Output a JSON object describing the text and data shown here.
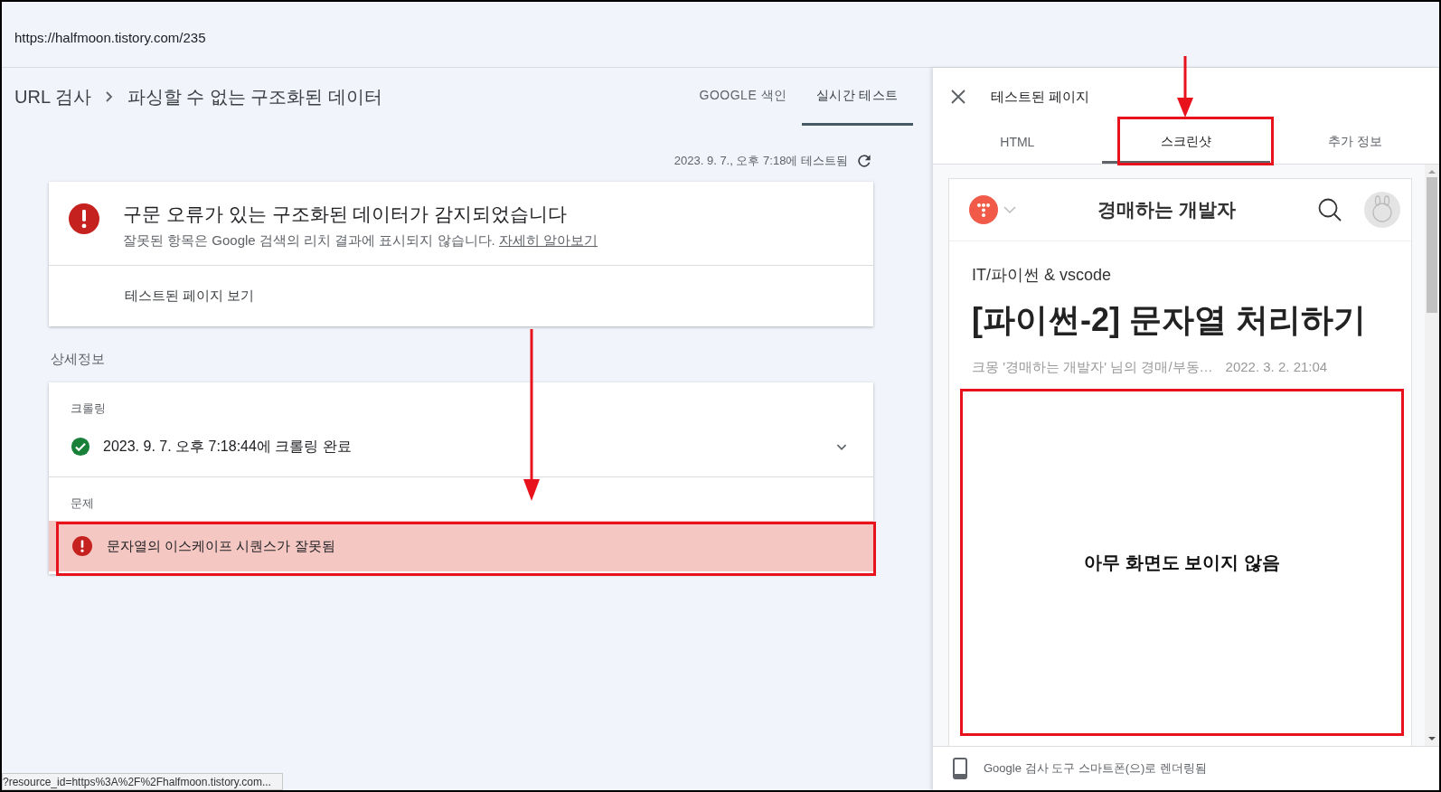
{
  "address_bar": {
    "url": "https://halfmoon.tistory.com/235"
  },
  "header": {
    "root": "URL 검사",
    "current": "파싱할 수 없는 구조화된 데이터"
  },
  "tabs": [
    {
      "label": "GOOGLE 색인",
      "selected": false
    },
    {
      "label": "실시간 테스트",
      "selected": true
    }
  ],
  "test_time": "2023. 9. 7., 오후 7:18에 테스트됨",
  "summary_card": {
    "title": "구문 오류가 있는 구조화된 데이터가 감지되었습니다",
    "description": "잘못된 항목은 Google 검색의 리치 결과에 표시되지 않습니다.",
    "link": "자세히 알아보기",
    "action": "테스트된 페이지 보기"
  },
  "details_heading": "상세정보",
  "crawl": {
    "label": "크롤링",
    "status": "2023. 9. 7. 오후 7:18:44에 크롤링 완료"
  },
  "issues": {
    "label": "문제",
    "items": [
      {
        "text": "문자열의 이스케이프 시퀀스가 잘못됨"
      }
    ]
  },
  "panel": {
    "title": "테스트된 페이지",
    "tabs": [
      {
        "label": "HTML",
        "selected": false
      },
      {
        "label": "스크린샷",
        "selected": true
      },
      {
        "label": "추가 정보",
        "selected": false
      }
    ],
    "screenshot": {
      "blog_title": "경매하는 개발자",
      "category": "IT/파이썬 & vscode",
      "post_title": "[파이썬-2] 문자열 처리하기",
      "author": "크몽 '경매하는 개발자' 님의 경매/부동…",
      "date": "2022. 3. 2. 21:04",
      "note": "아무 화면도 보이지 않음"
    },
    "footer": "Google 검사 도구 스마트폰(으)로 렌더링됨"
  },
  "status_bar": {
    "url": "?resource_id=https%3A%2F%2Fhalfmoon.tistory.com..."
  }
}
